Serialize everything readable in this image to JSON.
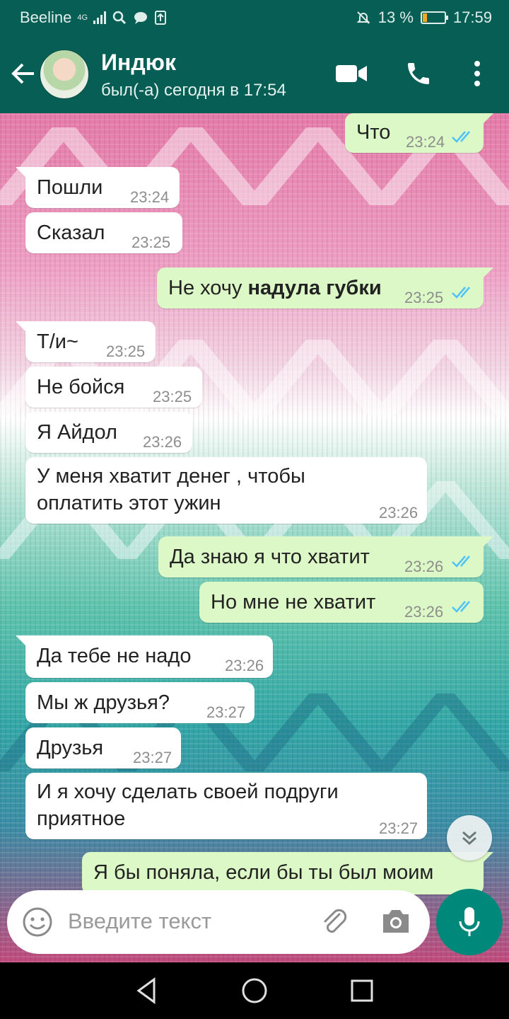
{
  "status_bar": {
    "carrier": "Beeline",
    "network": "4G",
    "battery_pct": "13 %",
    "time": "17:59",
    "battery_color": "#f5a623"
  },
  "header": {
    "contact_name": "Индюк",
    "contact_status": "был(-а) сегодня в 17:54"
  },
  "messages": [
    {
      "text": "Что",
      "time": "23:24",
      "direction": "out",
      "read": true
    },
    {
      "text": "Пошли",
      "time": "23:24",
      "direction": "in"
    },
    {
      "text": "Сказал",
      "time": "23:25",
      "direction": "in"
    },
    {
      "text_plain": "Не хочу ",
      "text_bold": "надула губки",
      "time": "23:25",
      "direction": "out",
      "read": true
    },
    {
      "text": "Т/и~",
      "time": "23:25",
      "direction": "in"
    },
    {
      "text": "Не бойся",
      "time": "23:25",
      "direction": "in"
    },
    {
      "text": "Я Айдол",
      "time": "23:26",
      "direction": "in"
    },
    {
      "line1": "У меня хватит денег , чтобы",
      "line2": "оплатить этот ужин",
      "time": "23:26",
      "direction": "in"
    },
    {
      "text": "Да знаю я что хватит",
      "time": "23:26",
      "direction": "out",
      "read": true
    },
    {
      "text": "Но мне не хватит",
      "time": "23:26",
      "direction": "out",
      "read": true
    },
    {
      "text": "Да тебе не надо",
      "time": "23:26",
      "direction": "in"
    },
    {
      "text": "Мы ж друзья?",
      "time": "23:27",
      "direction": "in"
    },
    {
      "text": "Друзья",
      "time": "23:27",
      "direction": "in"
    },
    {
      "line1": "И я хочу сделать своей подруги",
      "line2": "приятное",
      "time": "23:27",
      "direction": "in"
    },
    {
      "text": "Я бы поняла, если бы ты был моим",
      "direction": "out"
    }
  ],
  "input": {
    "placeholder": "Введите текст"
  },
  "colors": {
    "header": "#075E54",
    "outgoing": "#dcf8c6",
    "incoming": "#ffffff",
    "tick_read": "#4fc3f7",
    "fab": "#00897B"
  },
  "icons": [
    "back-arrow-icon",
    "video-call-icon",
    "phone-icon",
    "more-vert-icon",
    "emoji-icon",
    "attach-icon",
    "camera-icon",
    "mic-icon",
    "scroll-down-icon",
    "nav-back-icon",
    "nav-home-icon",
    "nav-recents-icon"
  ]
}
